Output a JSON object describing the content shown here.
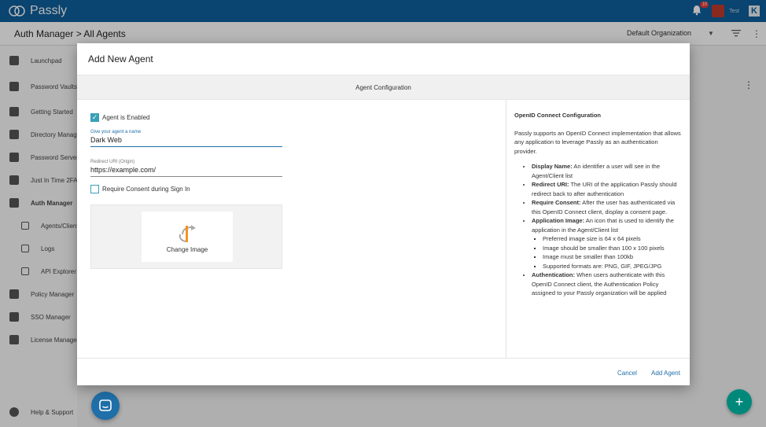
{
  "app": {
    "brand": "Passly",
    "notification_count": "10",
    "user": "Test"
  },
  "header": {
    "breadcrumb": "Auth Manager > All Agents",
    "organization": "Default Organization"
  },
  "sidebar": {
    "items": [
      {
        "label": "Launchpad"
      },
      {
        "label": "Password Vaults"
      },
      {
        "label": "Getting Started"
      },
      {
        "label": "Directory Manager"
      },
      {
        "label": "Password Server"
      },
      {
        "label": "Just In Time 2FA"
      },
      {
        "label": "Auth Manager"
      },
      {
        "label": "Agents/Clients"
      },
      {
        "label": "Logs"
      },
      {
        "label": "API Explorer"
      },
      {
        "label": "Policy Manager"
      },
      {
        "label": "SSO Manager"
      },
      {
        "label": "License Manager"
      }
    ],
    "help": "Help & Support"
  },
  "modal": {
    "title": "Add New Agent",
    "section_title": "Agent Configuration",
    "enabled_label": "Agent is Enabled",
    "enabled_checked": true,
    "name_label": "Give your agent a name",
    "name_value": "Dark Web",
    "redirect_label": "Redirect URI (Origin)",
    "redirect_value": "https://example.com/",
    "consent_label": "Require Consent during Sign In",
    "consent_checked": false,
    "change_image_label": "Change Image",
    "cancel_label": "Cancel",
    "add_label": "Add Agent"
  },
  "help_panel": {
    "title": "OpenID Connect Configuration",
    "intro": "Passly supports an OpenID Connect implementation that allows any application to leverage Passly as an authentication provider.",
    "display_name_term": "Display Name:",
    "display_name_text": " An identifier a user will see in the Agent/Client list",
    "redirect_term": "Redirect URI:",
    "redirect_text": " The URI of the application Passly should redirect back to after authentication",
    "consent_term": "Require Consent:",
    "consent_text": " After the user has authenticated via this OpenID Connect client, display a consent page.",
    "image_term": "Application Image:",
    "image_text": " An icon that is used to identify the application in the Agent/Client list",
    "image_rules": [
      "Preferred image size is 64 x 64 pixels",
      "Image should be smaller than 100 x 100 pixels",
      "Image must be smaller than 100kb",
      "Supported formats are: PNG, GIF, JPEG/JPG"
    ],
    "auth_term": "Authentication:",
    "auth_text": " When users authenticate with this OpenID Connect client, the Authentication Policy assigned to your Passly organization will be applied"
  },
  "colors": {
    "brand_bar": "#0f5f9b",
    "accent": "#3aa0b8",
    "link": "#1f6fa8",
    "fab": "#00897b"
  }
}
